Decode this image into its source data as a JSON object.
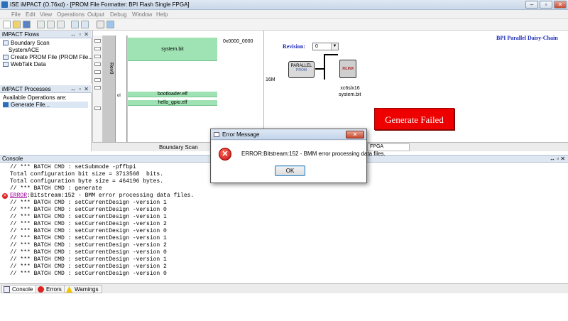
{
  "window": {
    "title": "ISE iMPACT (O.76xd) - [PROM File Formatter: BPI Flash Single FPGA]",
    "minimize": "–",
    "restore": "▫",
    "close": "✕"
  },
  "menu": [
    "File",
    "Edit",
    "View",
    "Operations",
    "Output",
    "Debug",
    "Window",
    "Help"
  ],
  "flows_panel": {
    "title": "iMPACT Flows",
    "controls": "↔ ▫ ✕",
    "items": [
      "Boundary Scan",
      "SystemACE",
      "Create PROM File (PROM File...",
      "WebTalk Data"
    ]
  },
  "processes_panel": {
    "title": "iMPACT Processes",
    "controls": "↔ ▫ ✕",
    "available_label": "Available Operations are:",
    "items": [
      "Generate File..."
    ]
  },
  "prom": {
    "address": "0x0000_0000",
    "rev_label": "Rev0",
    "row_marker": "ol",
    "blocks": [
      "system.bit",
      "bootloader.elf",
      "hello_gpio.elf"
    ],
    "tab": "Boundary Scan"
  },
  "device_view": {
    "chain_title": "BPI Parallel Daisy-Chain",
    "revision_label": "Revision:",
    "revision_value": "0",
    "parallel_chip_line1": "PARALLEL",
    "parallel_chip_line2": "PROM",
    "fpga_chip_label": "XILINX",
    "size_label": "16M",
    "fpga_name": "xc6slx16",
    "fpga_file": "system.bit",
    "generate_status": "Generate Failed",
    "tab": "FPGA"
  },
  "console": {
    "title": "Console",
    "controls": "↔ ▫ ✕",
    "lines_before": [
      "// *** BATCH CMD : setSubmode -pffbpi",
      "Total configuration bit size = 3713568  bits.",
      "Total configuration byte size = 464196 bytes.",
      "// *** BATCH CMD : generate"
    ],
    "error_word": "ERROR",
    "error_rest": ":Bitstream:152 - BMM error processing data files.",
    "lines_after": [
      "// *** BATCH CMD : setCurrentDesign -version 1",
      "// *** BATCH CMD : setCurrentDesign -version 0",
      "// *** BATCH CMD : setCurrentDesign -version 1",
      "// *** BATCH CMD : setCurrentDesign -version 2",
      "// *** BATCH CMD : setCurrentDesign -version 0",
      "// *** BATCH CMD : setCurrentDesign -version 1",
      "// *** BATCH CMD : setCurrentDesign -version 2",
      "// *** BATCH CMD : setCurrentDesign -version 0",
      "// *** BATCH CMD : setCurrentDesign -version 1",
      "// *** BATCH CMD : setCurrentDesign -version 2",
      "// *** BATCH CMD : setCurrentDesign -version 0"
    ],
    "tabs": [
      "Console",
      "Errors",
      "Warnings"
    ]
  },
  "dialog": {
    "title": "Error Message",
    "close": "✕",
    "message": "ERROR:Bitstream:152 - BMM error processing data files.",
    "ok_label": "OK"
  }
}
